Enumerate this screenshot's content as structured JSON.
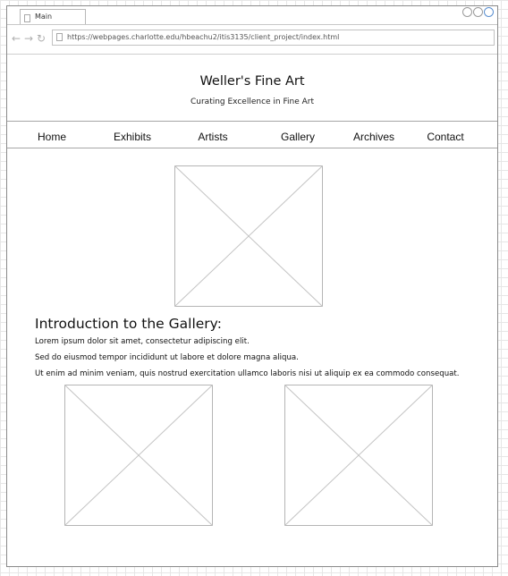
{
  "browser": {
    "tab_label": "Main",
    "url": "https://webpages.charlotte.edu/hbeachu2/itis3135/client_project/index.html",
    "nav_icons": [
      "back-arrow-icon",
      "forward-arrow-icon",
      "reload-icon"
    ]
  },
  "header": {
    "title": "Weller's Fine Art",
    "tagline": "Curating Excellence in Fine Art"
  },
  "nav": {
    "items": [
      {
        "label": "Home"
      },
      {
        "label": "Exhibits"
      },
      {
        "label": "Artists"
      },
      {
        "label": "Gallery"
      },
      {
        "label": "Archives"
      },
      {
        "label": "Contact"
      }
    ]
  },
  "intro": {
    "heading": "Introduction to the Gallery:",
    "paragraphs": [
      "Lorem ipsum dolor sit amet, consectetur adipiscing elit.",
      "Sed do eiusmod tempor incididunt ut labore et dolore magna aliqua.",
      "Ut enim ad minim veniam, quis nostrud exercitation ullamco laboris nisi ut aliquip ex ea commodo consequat."
    ]
  }
}
